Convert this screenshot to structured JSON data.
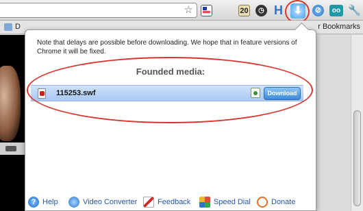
{
  "toolbar": {
    "star_glyph": "☆",
    "ext_20_label": "20",
    "ext_h_label": "H",
    "wrench_glyph": "🔧"
  },
  "bookmarks_bar": {
    "left_text": "D",
    "right_text": "r Bookmarks"
  },
  "popup": {
    "note": "Note that delays are possible before downloading. We hope that in feature versions of Chrome it will be fixed.",
    "title": "Founded media:",
    "media_items": [
      {
        "file_name": "115253.swf",
        "download_label": "Download"
      }
    ],
    "footer": {
      "help": "Help",
      "video_converter": "Video Converter",
      "feedback": "Feedback",
      "speed_dial": "Speed Dial",
      "donate": "Donate"
    }
  },
  "colors": {
    "highlight_red": "#d6362f",
    "row_blue": "#a9c7f3",
    "button_blue": "#3b8ad8",
    "link_blue": "#2455a8"
  }
}
